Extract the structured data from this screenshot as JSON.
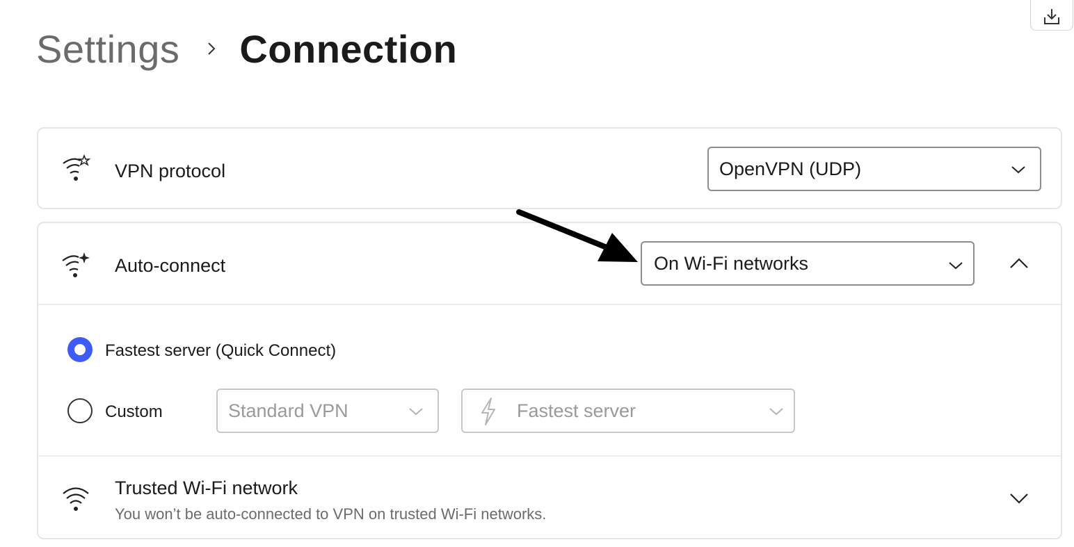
{
  "header": {
    "breadcrumb_parent": "Settings",
    "breadcrumb_current": "Connection"
  },
  "vpn_protocol": {
    "label": "VPN protocol",
    "selected": "OpenVPN (UDP)"
  },
  "auto_connect": {
    "label": "Auto-connect",
    "selected": "On Wi-Fi networks",
    "expanded": true,
    "options": {
      "fastest_label": "Fastest server (Quick Connect)",
      "custom_label": "Custom",
      "selected_option": "fastest",
      "custom_server_type": "Standard VPN",
      "custom_server": "Fastest server"
    }
  },
  "trusted_wifi": {
    "label": "Trusted Wi-Fi network",
    "description": "You won’t be auto-connected to VPN on trusted Wi-Fi networks."
  },
  "icons": {
    "export": "export-icon",
    "vpn_protocol": "wifi-star-icon",
    "auto_connect": "wifi-sparkle-icon",
    "trusted_wifi": "wifi-icon",
    "fastest_server": "lightning-icon"
  },
  "colors": {
    "accent": "#3f5bf6",
    "annotation_arrow": "#000000"
  }
}
